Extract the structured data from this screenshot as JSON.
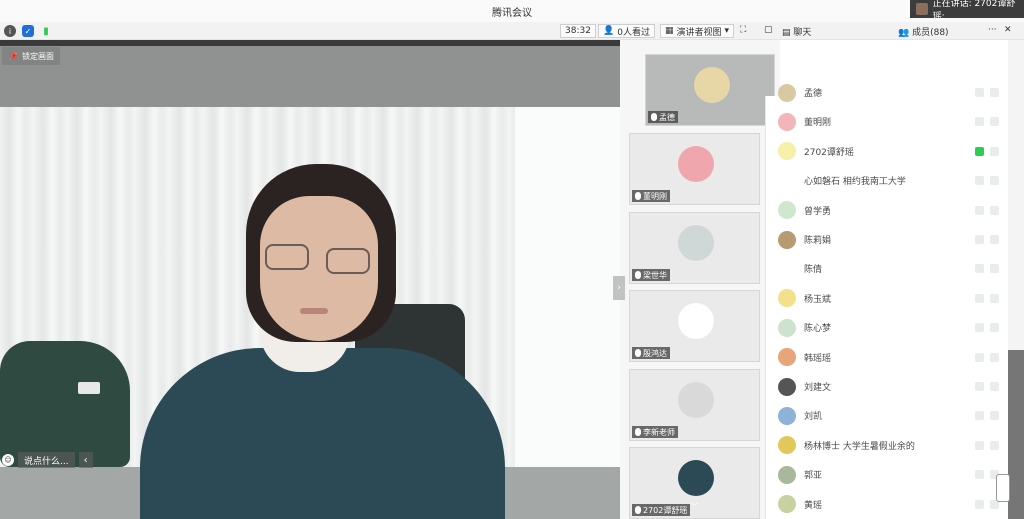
{
  "window": {
    "title": "腾讯会议",
    "speaking_label": "正在讲话: 2702谭舒瑶;"
  },
  "toolbar": {
    "timer": "38:32",
    "viewer_count": "0人看过",
    "view_mode": "演讲者视图",
    "chat_label": "聊天",
    "members_label": "成员(88)",
    "more": "···",
    "close": "✕"
  },
  "main_video": {
    "pin_label": "锁定画面",
    "chat_placeholder": "说点什么..."
  },
  "thumbnails": [
    {
      "name": "孟德",
      "avatar_color": "#e8d7a6"
    },
    {
      "name": "董明刚",
      "avatar_color": "#f0a6ad"
    },
    {
      "name": "梁世华",
      "avatar_color": "#cfd8d6"
    },
    {
      "name": "殷鸿达",
      "avatar_color": "#ffffff"
    },
    {
      "name": "李新老师",
      "avatar_color": "#d9d9d9"
    },
    {
      "name": "2702谭舒瑶",
      "avatar_color": "#2b4a55"
    }
  ],
  "members": [
    {
      "name": "孟德",
      "avatar_color": "#d8c9a2"
    },
    {
      "name": "董明刚",
      "avatar_color": "#f2b5b8"
    },
    {
      "name": "2702谭舒瑶",
      "avatar_color": "#f7f0a8",
      "speaking": true
    },
    {
      "name": "心如磐石 相约我南工大学",
      "avatar_color": "#ffffff"
    },
    {
      "name": "曾学勇",
      "avatar_color": "#cfe6cf"
    },
    {
      "name": "陈莉娟",
      "avatar_color": "#b89a73"
    },
    {
      "name": "陈倩",
      "avatar_color": "#ffffff"
    },
    {
      "name": "杨玉斌",
      "avatar_color": "#f3e08a"
    },
    {
      "name": "陈心梦",
      "avatar_color": "#cde3cf"
    },
    {
      "name": "韩瑶瑶",
      "avatar_color": "#e9a57a"
    },
    {
      "name": "刘建文",
      "avatar_color": "#555555"
    },
    {
      "name": "刘凯",
      "avatar_color": "#8fb2d9"
    },
    {
      "name": "杨林博士 大学生暑假业余的",
      "avatar_color": "#e0c85a"
    },
    {
      "name": "郭亚",
      "avatar_color": "#a8b89a"
    },
    {
      "name": "黄瑶",
      "avatar_color": "#c8d2a0"
    }
  ],
  "colors": {
    "speaking_green": "#2ecc52",
    "toolbar_bg": "#f2f2f2",
    "badge_blue": "#1e6fd9"
  }
}
